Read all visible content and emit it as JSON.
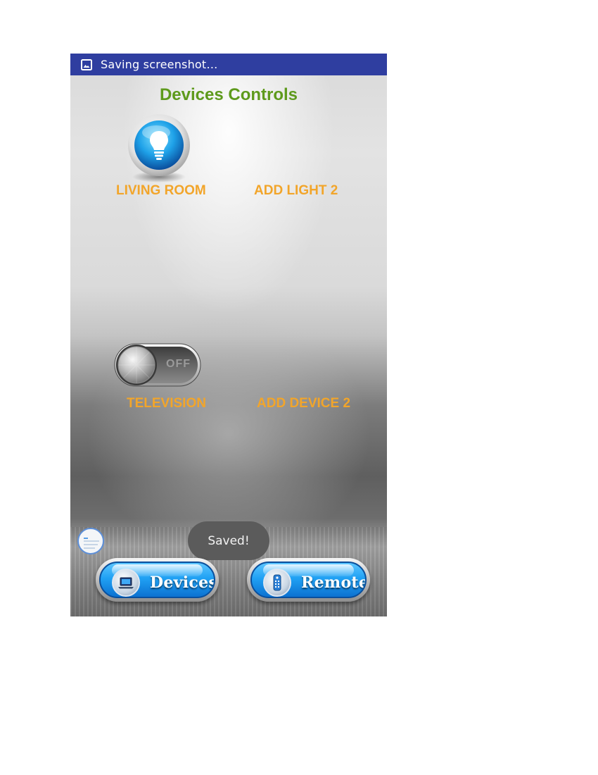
{
  "status_bar": {
    "icon": "image-icon",
    "text": "Saving screenshot…",
    "background": "#2f3ea0"
  },
  "screen": {
    "title": "Devices Controls",
    "title_color": "#5e9a1c",
    "label_color": "#f2a52a"
  },
  "lights": [
    {
      "label": "LIVING ROOM",
      "icon": "light-bulb-icon"
    },
    {
      "label": "ADD LIGHT 2"
    }
  ],
  "devices": [
    {
      "label": "TELEVISION",
      "toggle": {
        "state": "OFF",
        "icon": "toggle-switch-icon"
      }
    },
    {
      "label": "ADD DEVICE 2"
    }
  ],
  "toast": {
    "text": "Saved!"
  },
  "bottom_nav": [
    {
      "label": "Devices",
      "icon": "laptop-icon",
      "accent": "#20a1f4"
    },
    {
      "label": "Remote",
      "icon": "remote-control-icon",
      "accent": "#20a1f4"
    }
  ],
  "overlay": {
    "icon": "screenshot-thumbnail-icon"
  }
}
